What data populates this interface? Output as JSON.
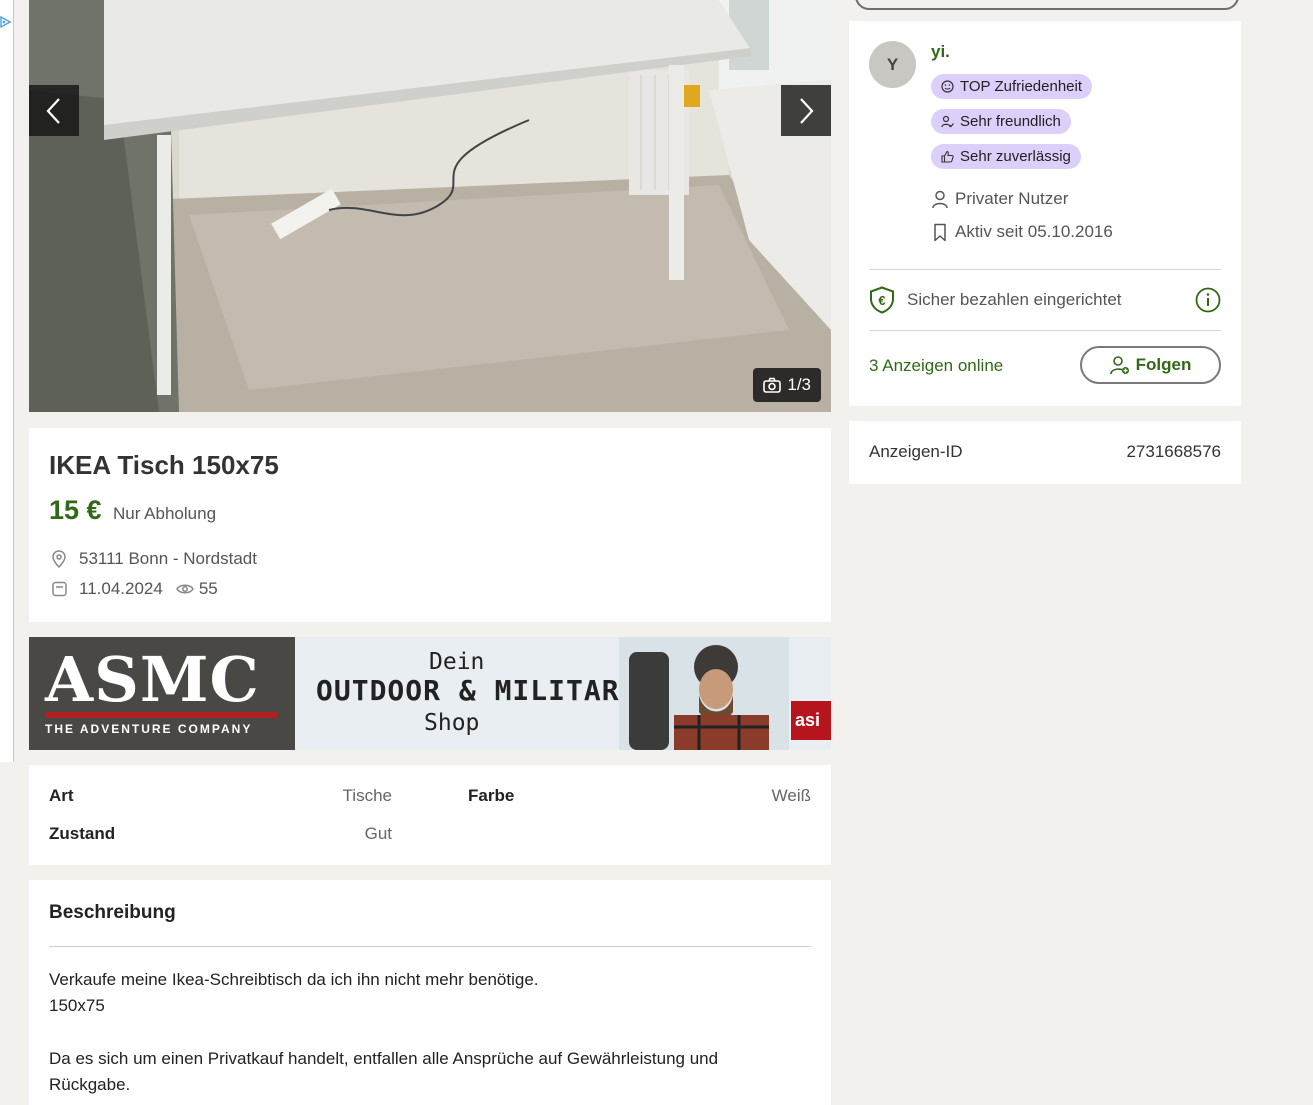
{
  "gallery": {
    "counter": "1/3",
    "prev_icon": "chevron-left-icon",
    "next_icon": "chevron-right-icon",
    "camera_icon": "camera-icon"
  },
  "listing": {
    "title": "IKEA Tisch 150x75",
    "price": "15 €",
    "shipping": "Nur Abholung",
    "location": "53111 Bonn - Nordstadt",
    "date": "11.04.2024",
    "views": "55"
  },
  "banner": {
    "logo": "ASMC",
    "logo_sub": "THE ADVENTURE COMPANY",
    "line1": "Dein",
    "line2": "OUTDOOR & MILITARY",
    "line3": "Shop",
    "tab": "asi"
  },
  "details": [
    {
      "label": "Art",
      "value": "Tische"
    },
    {
      "label": "Farbe",
      "value": "Weiß"
    },
    {
      "label": "Zustand",
      "value": "Gut"
    }
  ],
  "description": {
    "title": "Beschreibung",
    "lines": [
      "Verkaufe meine Ikea-Schreibtisch da ich ihn nicht mehr benötige.",
      "150x75",
      "",
      "Da es sich um einen Privatkauf handelt, entfallen alle Ansprüche auf Gewährleistung und",
      "Rückgabe."
    ]
  },
  "seller": {
    "avatar_initial": "Y",
    "name": "yi.",
    "badges": [
      "TOP Zufriedenheit",
      "Sehr freundlich",
      "Sehr zuverlässig"
    ],
    "user_type": "Privater Nutzer",
    "active_since": "Aktiv seit 05.10.2016",
    "secure_payment": "Sicher bezahlen eingerichtet",
    "ads_online": "3 Anzeigen online",
    "follow_label": "Folgen"
  },
  "ad_id": {
    "label": "Anzeigen-ID",
    "value": "2731668576"
  },
  "colors": {
    "accent_green": "#326916",
    "badge_purple": "#dccffa",
    "page_bg": "#f2f1ed"
  }
}
